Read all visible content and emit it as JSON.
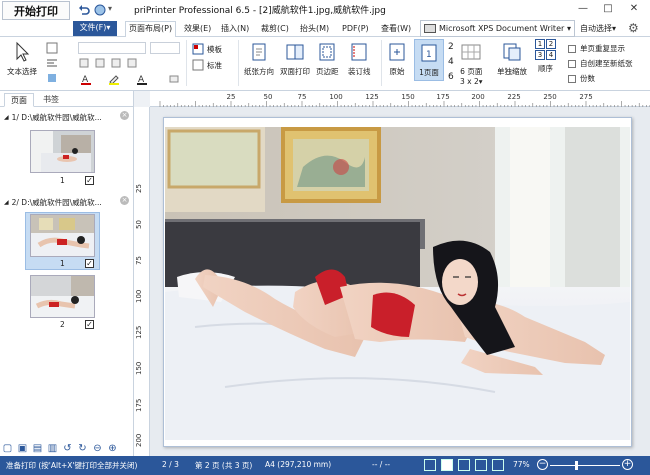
{
  "titlebar": {
    "start_print": "开始打印",
    "title": "priPrinter Professional 6.5 - [2]威航软件1.jpg,威航软件.jpg",
    "minimize": "—",
    "maximize": "□",
    "close": "✕"
  },
  "tabs": {
    "file": "文件(F)▾",
    "layout": "页面布局(P)",
    "effects": "效果(E)",
    "insert": "插入(N)",
    "crop": "裁剪(C)",
    "header": "抬头(M)",
    "pdf": "PDF(P)",
    "view": "查看(W)",
    "printer": "Microsoft XPS Document Writer",
    "auto_select": "自动选择▾"
  },
  "ribbon": {
    "text_select": "文本选择",
    "template_label": "模板",
    "standard_label": "标准",
    "paper_direction": "纸张方向",
    "duplex": "双面打印",
    "margins": "页边距",
    "binding": "装订线",
    "original": "原始",
    "one_page": "1页面",
    "n1": "2",
    "n2": "4",
    "n3": "6",
    "six_pages": "6 页面",
    "grid_label": "3 x 2▾",
    "single_zoom": "单独缩放",
    "order": "顺序",
    "order_nums": [
      "1",
      "2",
      "3",
      "4"
    ],
    "single_repeat": "单页重复显示",
    "auto_new_sheet": "自创建至新纸张",
    "copies": "份数"
  },
  "panel": {
    "tab_pages": "页面",
    "tab_bookmarks": "书签",
    "doc1": "1/ D:\\威航软件园\\威航软...",
    "doc2": "2/ D:\\威航软件园\\威航软...",
    "doc1_page": "1",
    "doc2_page1": "1",
    "doc2_page2": "2",
    "check": "✓"
  },
  "ruler": {
    "top_ticks": [
      "25",
      "50",
      "75",
      "100",
      "125",
      "150",
      "175",
      "200",
      "225",
      "250",
      "275"
    ],
    "left_ticks": [
      "25",
      "50",
      "75",
      "100",
      "125",
      "150",
      "175",
      "200"
    ]
  },
  "statusbar": {
    "ready": "准备打印 (按'Alt+X'键打印全部并关闭)",
    "page_index": "2 / 3",
    "page_of": "第 2 页 (共 3 页)",
    "paper": "A4 (297,210 mm)",
    "page_range": "-- / --",
    "zoom": "77%",
    "minus": "−",
    "plus": "+"
  },
  "colors": {
    "accent": "#2b579a",
    "status_bg": "#2b579a",
    "page_bg": "#e7ebf0"
  }
}
